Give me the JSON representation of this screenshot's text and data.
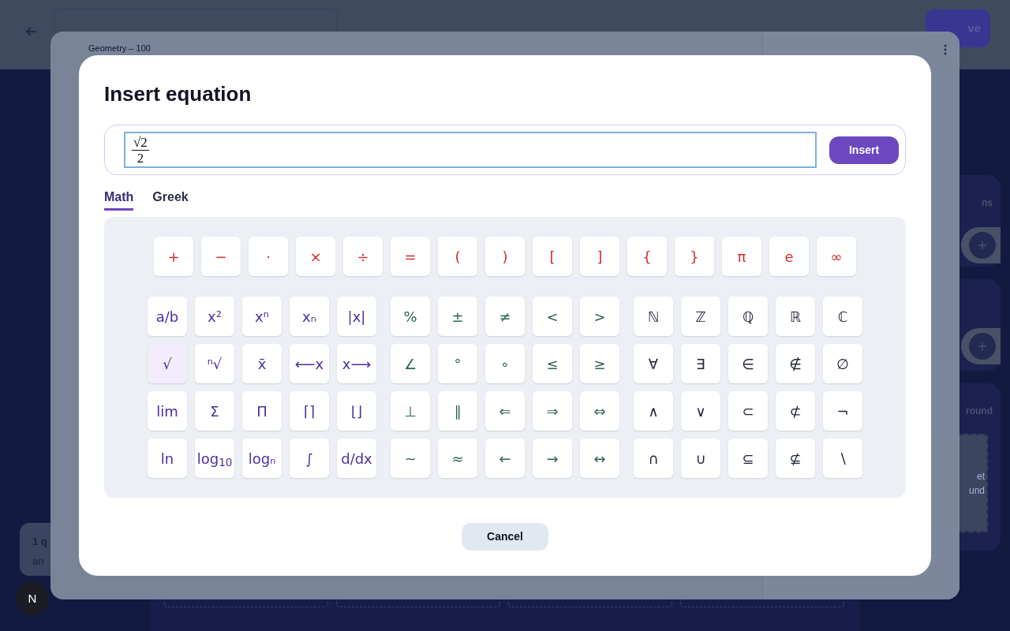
{
  "page": {
    "back_label": "Geometry – 100",
    "save_button": "ve",
    "cards": [
      {
        "kind": "add",
        "title": "ns"
      },
      {
        "kind": "add"
      },
      {
        "kind": "dropzone",
        "title": "round",
        "lines": [
          "et",
          "und"
        ]
      }
    ],
    "tooltip": {
      "lines": [
        "1 q",
        "an"
      ]
    },
    "avatar": "N"
  },
  "dialog": {
    "title": "Insert equation",
    "equation": {
      "numerator": "√2",
      "denominator": "2"
    },
    "insert_button": "Insert",
    "tabs": [
      {
        "label": "Math",
        "selected": true
      },
      {
        "label": "Greek",
        "selected": false
      }
    ],
    "keypad": {
      "groups": [
        {
          "color": "#d32f2f",
          "keys": [
            {
              "label": "+",
              "selected": false
            },
            {
              "label": "−",
              "selected": false
            },
            {
              "label": "·",
              "selected": false
            },
            {
              "label": "×",
              "selected": false
            },
            {
              "label": "÷",
              "selected": false
            },
            {
              "label": "=",
              "selected": false
            },
            {
              "label": "(",
              "selected": false
            },
            {
              "label": ")",
              "selected": false
            },
            {
              "label": "[",
              "selected": false
            },
            {
              "label": "]",
              "selected": false
            },
            {
              "label": "{",
              "selected": false
            },
            {
              "label": "}",
              "selected": false
            },
            {
              "label": "π",
              "selected": false
            },
            {
              "label": "e",
              "selected": false
            },
            {
              "label": "∞",
              "selected": false
            }
          ]
        },
        {
          "color": "#4c2f9e",
          "keys": [
            {
              "label": "a/b",
              "selected": false
            },
            {
              "label": "x²",
              "selected": false
            },
            {
              "label": "xⁿ",
              "selected": false
            },
            {
              "label": "xₙ",
              "selected": false
            },
            {
              "label": "|x|",
              "selected": false
            },
            {
              "label": "√",
              "selected": true
            },
            {
              "label": "ⁿ√",
              "selected": false
            },
            {
              "label": "x̄",
              "selected": false
            },
            {
              "label": "⟵x",
              "selected": false
            },
            {
              "label": "x⟶",
              "selected": false
            },
            {
              "label": "lim",
              "selected": false
            },
            {
              "label": "Σ",
              "selected": false
            },
            {
              "label": "Π",
              "selected": false
            },
            {
              "label": "⌈⌉",
              "selected": false
            },
            {
              "label": "⌊⌋",
              "selected": false
            },
            {
              "label": "ln",
              "selected": false
            },
            {
              "label": "log$_{10}$",
              "selected": false
            },
            {
              "label": "logₙ",
              "selected": false
            },
            {
              "label": "∫",
              "selected": false
            },
            {
              "label": "d/dx",
              "selected": false
            }
          ]
        },
        {
          "color": "#2e6650",
          "keys": [
            {
              "label": "%",
              "selected": false
            },
            {
              "label": "±",
              "selected": false
            },
            {
              "label": "≠",
              "selected": false
            },
            {
              "label": "<",
              "selected": false
            },
            {
              "label": ">",
              "selected": false
            },
            {
              "label": "∠",
              "selected": false
            },
            {
              "label": "°",
              "selected": false
            },
            {
              "label": "∘",
              "selected": false
            },
            {
              "label": "≤",
              "selected": false
            },
            {
              "label": "≥",
              "selected": false
            },
            {
              "label": "⊥",
              "selected": false
            },
            {
              "label": "∥",
              "selected": false
            },
            {
              "label": "⇐",
              "selected": false
            },
            {
              "label": "⇒",
              "selected": false
            },
            {
              "label": "⇔",
              "selected": false
            },
            {
              "label": "~",
              "selected": false
            },
            {
              "label": "≈",
              "selected": false
            },
            {
              "label": "←",
              "selected": false
            },
            {
              "label": "→",
              "selected": false
            },
            {
              "label": "↔",
              "selected": false
            }
          ]
        },
        {
          "color": "#1e2435",
          "keys": [
            {
              "label": "ℕ",
              "selected": false
            },
            {
              "label": "ℤ",
              "selected": false
            },
            {
              "label": "ℚ",
              "selected": false
            },
            {
              "label": "ℝ",
              "selected": false
            },
            {
              "label": "ℂ",
              "selected": false
            },
            {
              "label": "∀",
              "selected": false
            },
            {
              "label": "∃",
              "selected": false
            },
            {
              "label": "∈",
              "selected": false
            },
            {
              "label": "∉",
              "selected": false
            },
            {
              "label": "∅",
              "selected": false
            },
            {
              "label": "∧",
              "selected": false
            },
            {
              "label": "∨",
              "selected": false
            },
            {
              "label": "⊂",
              "selected": false
            },
            {
              "label": "⊄",
              "selected": false
            },
            {
              "label": "¬",
              "selected": false
            },
            {
              "label": "∩",
              "selected": false
            },
            {
              "label": "∪",
              "selected": false
            },
            {
              "label": "⊆",
              "selected": false
            },
            {
              "label": "⊈",
              "selected": false
            },
            {
              "label": "∖",
              "selected": false
            }
          ]
        }
      ]
    },
    "cancel_button": "Cancel"
  }
}
